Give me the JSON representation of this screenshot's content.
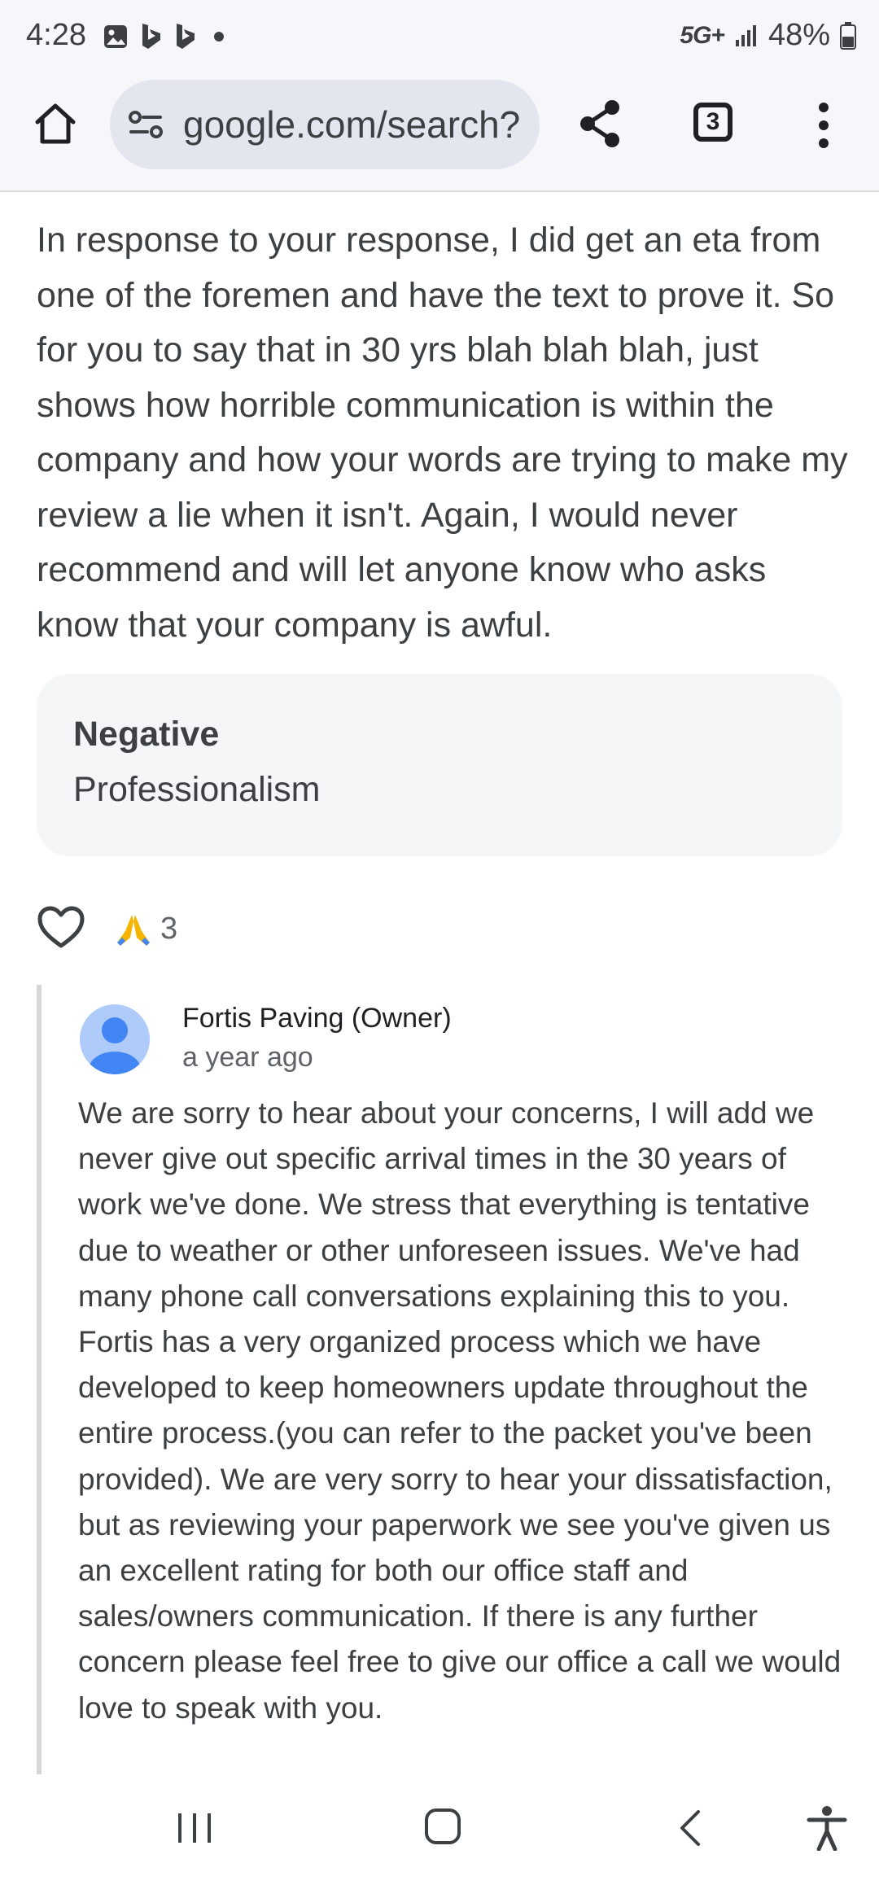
{
  "status_bar": {
    "time": "4:28",
    "network": "5G+",
    "battery": "48%"
  },
  "toolbar": {
    "url": "google.com/search?",
    "tab_count": "3"
  },
  "review": {
    "text": "In response to your response, I did get an eta from one of the foremen and have the text to prove it. So for you to say that in 30 yrs blah blah blah, just shows how horrible communication is within the company and how your words are trying to make my review a lie when it isn't. Again, I would never recommend and will let anyone know who asks know that your company is awful.",
    "sentiment": {
      "label": "Negative",
      "category": "Professionalism"
    },
    "reactions": {
      "count": "3"
    }
  },
  "owner_reply": {
    "name": "Fortis Paving (Owner)",
    "time": "a year ago",
    "text": "We are sorry to hear about your concerns, I will add we never give out specific arrival times in the 30 years of work we've done. We stress that everything is tentative due to weather or other unforeseen issues. We've had many phone call conversations explaining this to you. Fortis has a very organized process which we have developed to keep homeowners update throughout the entire process.(you can refer to the packet you've been provided). We are very sorry to hear your dissatisfaction, but as reviewing your paperwork we see you've given us an excellent rating for both our office staff and sales/owners communication. If there is any further concern please feel free to give our office a call we would love to speak with you."
  },
  "colors": {
    "avatar_fill": "#aecbfa",
    "avatar_figure": "#4285f4",
    "text": "#3c4043"
  }
}
